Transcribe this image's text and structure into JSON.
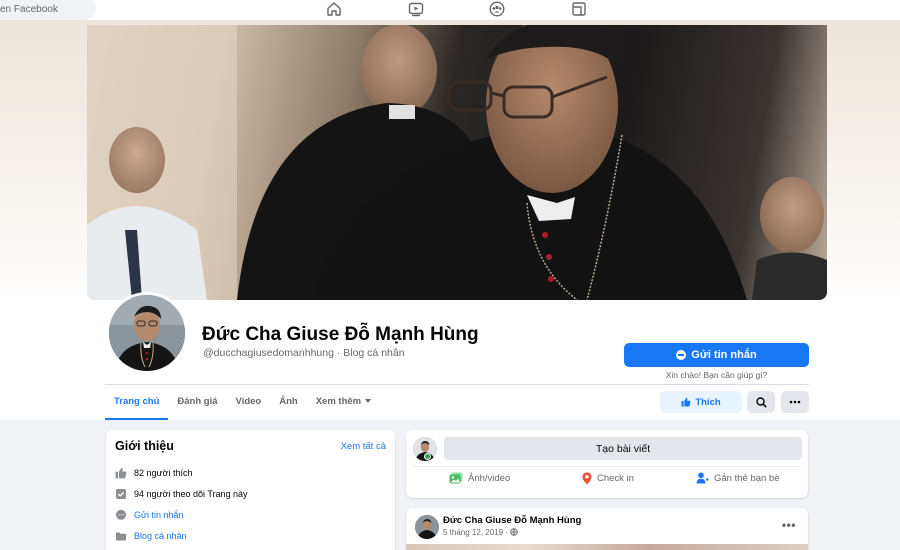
{
  "topbar": {
    "search_text": "en Facebook",
    "icons": [
      "home-icon",
      "video-icon",
      "groups-icon",
      "gaming-icon"
    ]
  },
  "profile": {
    "name": "Đức Cha Giuse Đỗ Mạnh Hùng",
    "subtitle": "@ducchagiusedomanhhung · Blog cá nhân",
    "message_button": "Gửi tin nhắn",
    "message_hint": "Xin chào! Bạn cần giúp gì?",
    "like_button": "Thích"
  },
  "tabs": [
    {
      "label": "Trang chủ",
      "active": true
    },
    {
      "label": "Đánh giá",
      "active": false
    },
    {
      "label": "Video",
      "active": false
    },
    {
      "label": "Ảnh",
      "active": false
    },
    {
      "label": "Xem thêm",
      "active": false
    }
  ],
  "intro": {
    "title": "Giới thiệu",
    "see_all": "Xem tất cả",
    "rows": [
      {
        "icon": "thumbs-up-icon",
        "text": "82 người thích"
      },
      {
        "icon": "check-square-icon",
        "text": "94 người theo dõi Trang này"
      },
      {
        "icon": "messenger-icon",
        "text": "Gửi tin nhắn"
      },
      {
        "icon": "folder-icon",
        "text": "Blog cá nhân"
      }
    ]
  },
  "composer": {
    "placeholder": "Tạo bài viết",
    "actions": [
      {
        "icon": "photo-icon",
        "label": "Ảnh/video",
        "color": "#45bd62"
      },
      {
        "icon": "location-pin-icon",
        "label": "Check in",
        "color": "#f5533d"
      },
      {
        "icon": "tag-friends-icon",
        "label": "Gắn thẻ bạn bè",
        "color": "#1877f2"
      }
    ]
  },
  "post": {
    "author": "Đức Cha Giuse Đỗ Mạnh Hùng",
    "date": "5 tháng 12, 2019 ·"
  },
  "colors": {
    "accent": "#1877f2",
    "background": "#f0f2f5",
    "secondary_text": "#65676b"
  }
}
